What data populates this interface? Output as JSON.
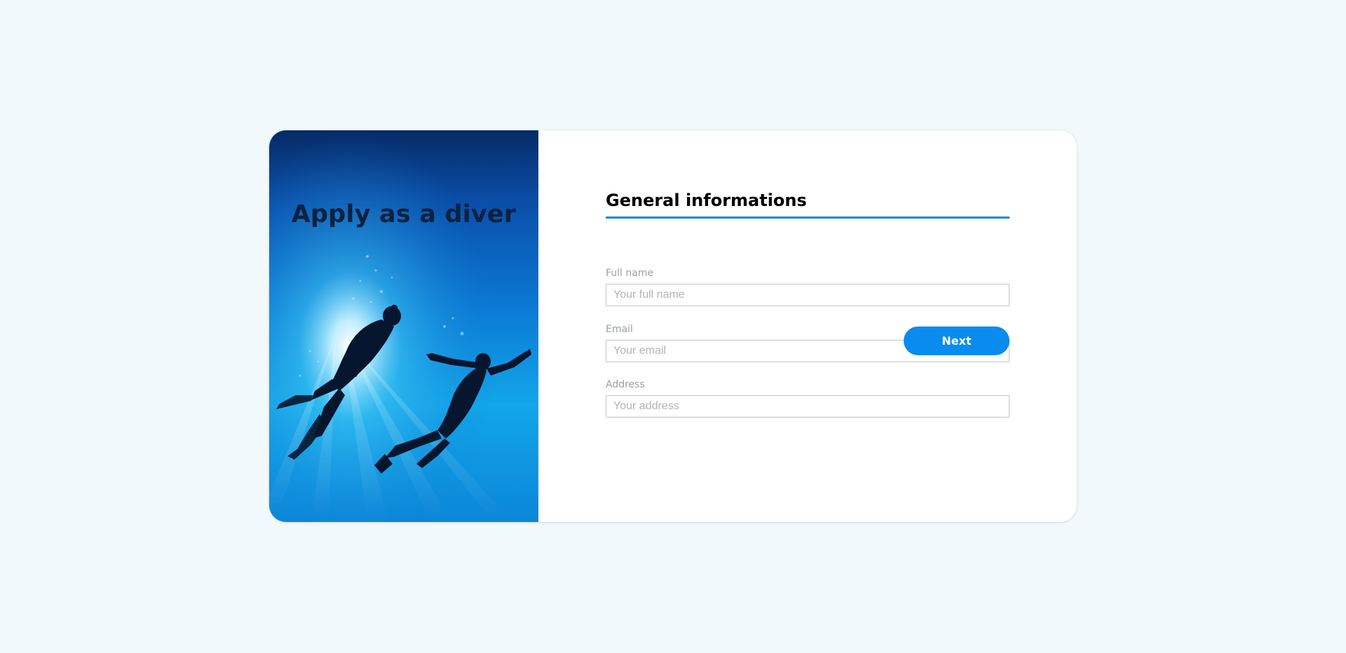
{
  "hero": {
    "title": "Apply as a diver",
    "image": "two-scuba-divers-silhouette-underwater"
  },
  "form": {
    "section_title": "General informations",
    "fields": [
      {
        "label": "Full name",
        "placeholder": "Your full name",
        "value": ""
      },
      {
        "label": "Email",
        "placeholder": "Your email",
        "value": ""
      },
      {
        "label": "Address",
        "placeholder": "Your address",
        "value": ""
      }
    ],
    "next_label": "Next"
  },
  "colors": {
    "page_background": "#f1f9fd",
    "card_background": "#ffffff",
    "accent": "#0a8bf0",
    "title_underline": "#1a86e0",
    "hero_title": "#0c2140"
  }
}
